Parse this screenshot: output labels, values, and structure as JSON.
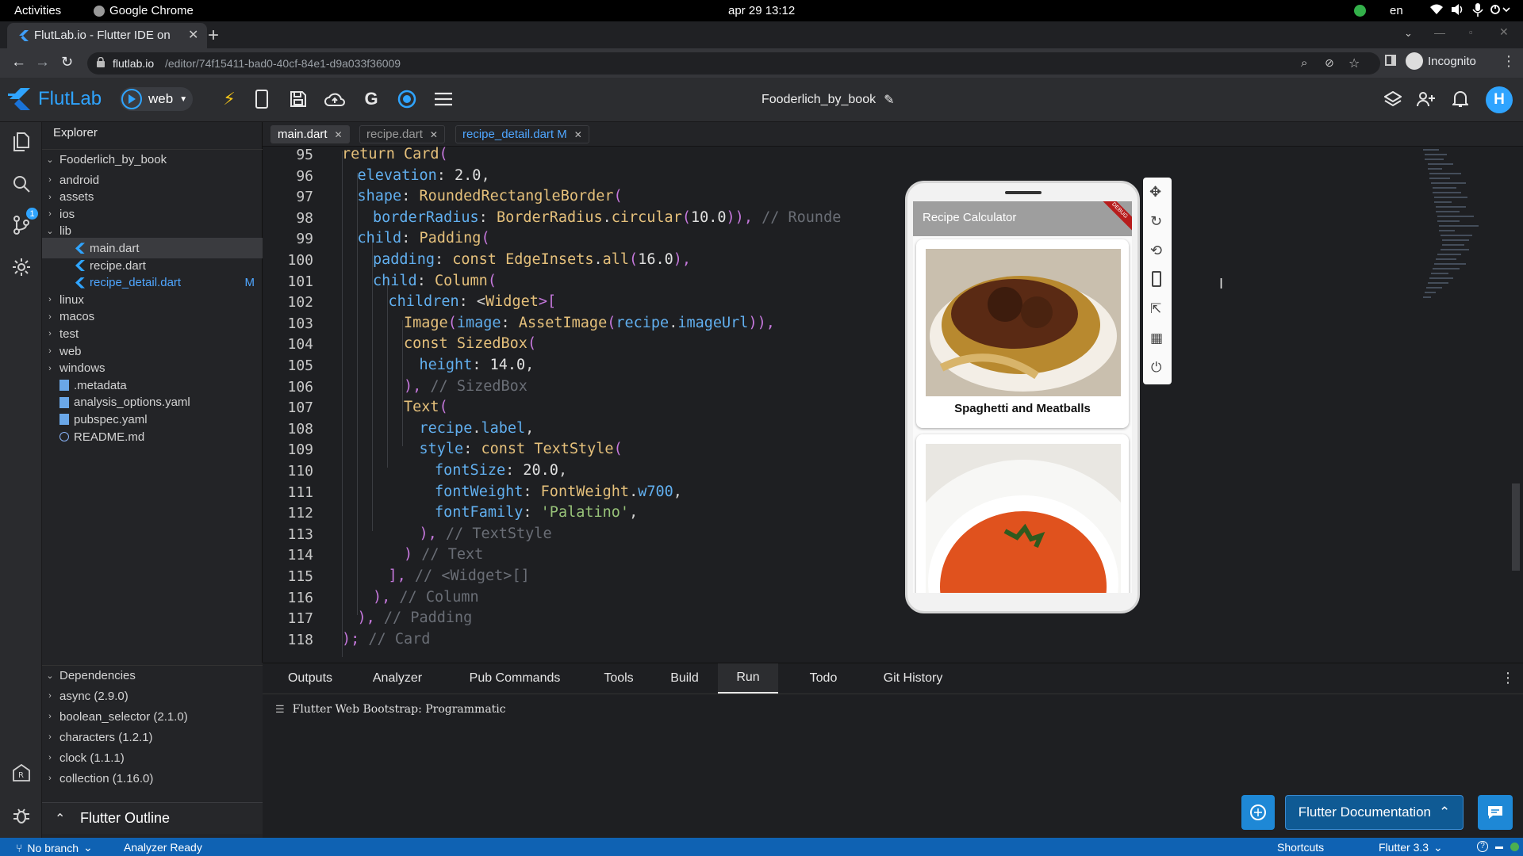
{
  "gnome": {
    "activities": "Activities",
    "app": "Google Chrome",
    "clock": "apr 29  13:12",
    "lang": "en"
  },
  "chrome": {
    "tab_title": "FlutLab.io - Flutter IDE on",
    "url_host": "flutlab.io",
    "url_path": "/editor/74f15411-bad0-40cf-84e1-d9a033f36009",
    "incognito": "Incognito"
  },
  "flutlab": {
    "logo": "FlutLab",
    "target": "web",
    "project": "Fooderlich_by_book",
    "avatar": "H"
  },
  "explorer": {
    "title": "Explorer",
    "root": "Fooderlich_by_book",
    "items": [
      {
        "label": "android",
        "kind": "folder",
        "depth": 1,
        "open": false
      },
      {
        "label": "assets",
        "kind": "folder",
        "depth": 1,
        "open": false
      },
      {
        "label": "ios",
        "kind": "folder",
        "depth": 1,
        "open": false
      },
      {
        "label": "lib",
        "kind": "folder",
        "depth": 1,
        "open": true
      },
      {
        "label": "main.dart",
        "kind": "dart",
        "depth": 2,
        "selected": true
      },
      {
        "label": "recipe.dart",
        "kind": "dart",
        "depth": 2
      },
      {
        "label": "recipe_detail.dart",
        "kind": "dart",
        "depth": 2,
        "modified": "M"
      },
      {
        "label": "linux",
        "kind": "folder",
        "depth": 1,
        "open": false
      },
      {
        "label": "macos",
        "kind": "folder",
        "depth": 1,
        "open": false
      },
      {
        "label": "test",
        "kind": "folder",
        "depth": 1,
        "open": false
      },
      {
        "label": "web",
        "kind": "folder",
        "depth": 1,
        "open": false
      },
      {
        "label": "windows",
        "kind": "folder",
        "depth": 1,
        "open": false
      },
      {
        "label": ".metadata",
        "kind": "file",
        "depth": 1
      },
      {
        "label": "analysis_options.yaml",
        "kind": "file",
        "depth": 1
      },
      {
        "label": "pubspec.yaml",
        "kind": "file",
        "depth": 1
      },
      {
        "label": "README.md",
        "kind": "info",
        "depth": 1
      }
    ]
  },
  "dependencies": {
    "title": "Dependencies",
    "items": [
      "async (2.9.0)",
      "boolean_selector (2.1.0)",
      "characters (1.2.1)",
      "clock (1.1.1)",
      "collection (1.16.0)"
    ],
    "outline": "Flutter Outline"
  },
  "editor_tabs": [
    {
      "label": "main.dart",
      "active": true
    },
    {
      "label": "recipe.dart",
      "active": false
    },
    {
      "label": "recipe_detail.dart M",
      "active": false
    }
  ],
  "code_lines": [
    {
      "n": "95",
      "text": "return Card("
    },
    {
      "n": "96",
      "text": "elevation: 2.0,"
    },
    {
      "n": "97",
      "text": "shape: RoundedRectangleBorder("
    },
    {
      "n": "98",
      "text": "borderRadius: BorderRadius.circular(10.0)), // Rounde"
    },
    {
      "n": "99",
      "text": "child: Padding("
    },
    {
      "n": "100",
      "text": "padding: const EdgeInsets.all(16.0),"
    },
    {
      "n": "101",
      "text": "child: Column("
    },
    {
      "n": "102",
      "text": "children: <Widget>["
    },
    {
      "n": "103",
      "text": "Image(image: AssetImage(recipe.imageUrl)),"
    },
    {
      "n": "104",
      "text": "const SizedBox("
    },
    {
      "n": "105",
      "text": "height: 14.0,"
    },
    {
      "n": "106",
      "text": "), // SizedBox"
    },
    {
      "n": "107",
      "text": "Text("
    },
    {
      "n": "108",
      "text": "recipe.label,"
    },
    {
      "n": "109",
      "text": "style: const TextStyle("
    },
    {
      "n": "110",
      "text": "fontSize: 20.0,"
    },
    {
      "n": "111",
      "text": "fontWeight: FontWeight.w700,"
    },
    {
      "n": "112",
      "text": "fontFamily: 'Palatino',"
    },
    {
      "n": "113",
      "text": "), // TextStyle"
    },
    {
      "n": "114",
      "text": ") // Text"
    },
    {
      "n": "115",
      "text": "], // <Widget>[]"
    },
    {
      "n": "116",
      "text": "), // Column"
    },
    {
      "n": "117",
      "text": "), // Padding"
    },
    {
      "n": "118",
      "text": "); // Card"
    }
  ],
  "preview": {
    "app_title": "Recipe Calculator",
    "debug": "DEBUG",
    "card1_label": "Spaghetti and Meatballs"
  },
  "bottom_tabs": [
    {
      "label": "Outputs"
    },
    {
      "label": "Analyzer"
    },
    {
      "label": "Pub Commands"
    },
    {
      "label": "Tools"
    },
    {
      "label": "Build"
    },
    {
      "label": "Run",
      "active": true
    },
    {
      "label": "Todo"
    },
    {
      "label": "Git History"
    }
  ],
  "console": {
    "line": "Flutter Web Bootstrap: Programmatic"
  },
  "docs_button": "Flutter Documentation",
  "statusbar": {
    "branch": "No branch",
    "analyzer": "Analyzer Ready",
    "shortcuts": "Shortcuts",
    "flutter": "Flutter 3.3"
  },
  "colors": {
    "accent": "#0f62b3",
    "keyword": "#e5c07b",
    "property": "#61afef",
    "string": "#98c379",
    "comment": "#6a6e76"
  },
  "badges": {
    "git": "1"
  }
}
